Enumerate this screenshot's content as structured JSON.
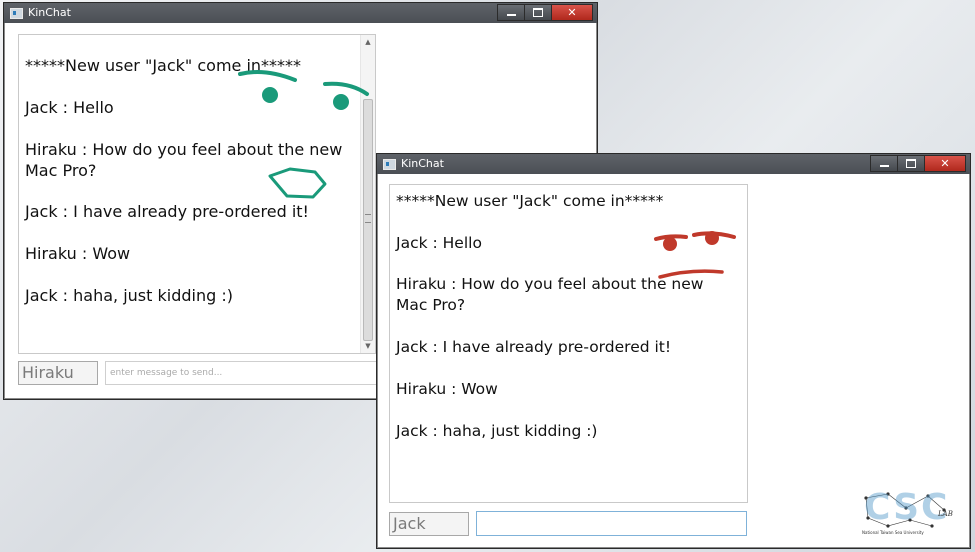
{
  "window1": {
    "title": "KinChat",
    "messages": [
      "*****New user \"Jack\" come in*****",
      "Jack : Hello",
      "Hiraku : How do you feel about the new Mac Pro?",
      "Jack : I have already pre-ordered it!",
      "Hiraku : Wow",
      "Jack : haha, just kidding :)"
    ],
    "username_value": "Hiraku",
    "message_placeholder": "enter message to send..."
  },
  "window2": {
    "title": "KinChat",
    "messages": [
      "*****New user \"Jack\" come in*****",
      "Jack : Hello",
      "Hiraku : How do you feel about the new Mac Pro?",
      "Jack : I have already pre-ordered it!",
      "Hiraku : Wow",
      "Jack : haha, just kidding :)"
    ],
    "username_value": "Jack",
    "message_value": ""
  },
  "logo": {
    "letters": "CSC",
    "lab": "LAB",
    "caption": "National Taiwan Sea University"
  },
  "colors": {
    "doodle_green": "#1a9a7a",
    "doodle_red": "#c0392b",
    "focus_border": "#7fb2d9"
  },
  "icons": [
    "app-icon",
    "minimize-icon",
    "maximize-icon",
    "close-icon",
    "scroll-up-icon",
    "scroll-down-icon",
    "scroll-grip-icon"
  ]
}
